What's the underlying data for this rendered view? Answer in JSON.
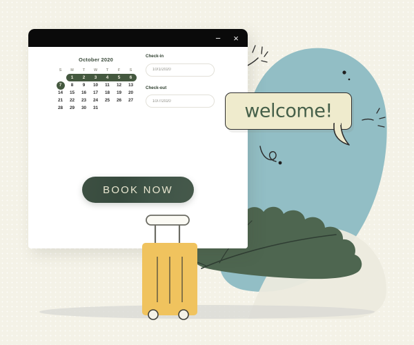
{
  "scene": {
    "title": "travel booking illustration",
    "background_color": "#f4f2e7",
    "blob_color": "#92bec5",
    "leaf_color": "#4e6650",
    "accent_green": "#44583f",
    "cream": "#efebcd",
    "suitcase_color": "#f0c35e"
  },
  "window": {
    "titlebar": {
      "minimize_label": "−",
      "close_label": "×"
    },
    "calendar": {
      "month_label": "October 2020",
      "weekdays": [
        "S",
        "M",
        "T",
        "W",
        "T",
        "F",
        "S"
      ],
      "weeks": [
        [
          "",
          "1",
          "2",
          "3",
          "4",
          "5",
          "6"
        ],
        [
          "7",
          "8",
          "9",
          "10",
          "11",
          "12",
          "13"
        ],
        [
          "14",
          "15",
          "16",
          "17",
          "18",
          "19",
          "20"
        ],
        [
          "21",
          "22",
          "23",
          "24",
          "25",
          "26",
          "27"
        ],
        [
          "28",
          "29",
          "30",
          "31",
          "",
          "",
          ""
        ]
      ],
      "selected_day": "7",
      "range_days": [
        "1",
        "2",
        "3",
        "4",
        "5",
        "6"
      ]
    },
    "form": {
      "checkin_label": "Check-in",
      "checkin_value": "10/1/2020",
      "checkout_label": "Check-out",
      "checkout_value": "10/7/2020"
    },
    "book_button_label": "BOOK NOW"
  },
  "bubble": {
    "text": "welcome!"
  }
}
